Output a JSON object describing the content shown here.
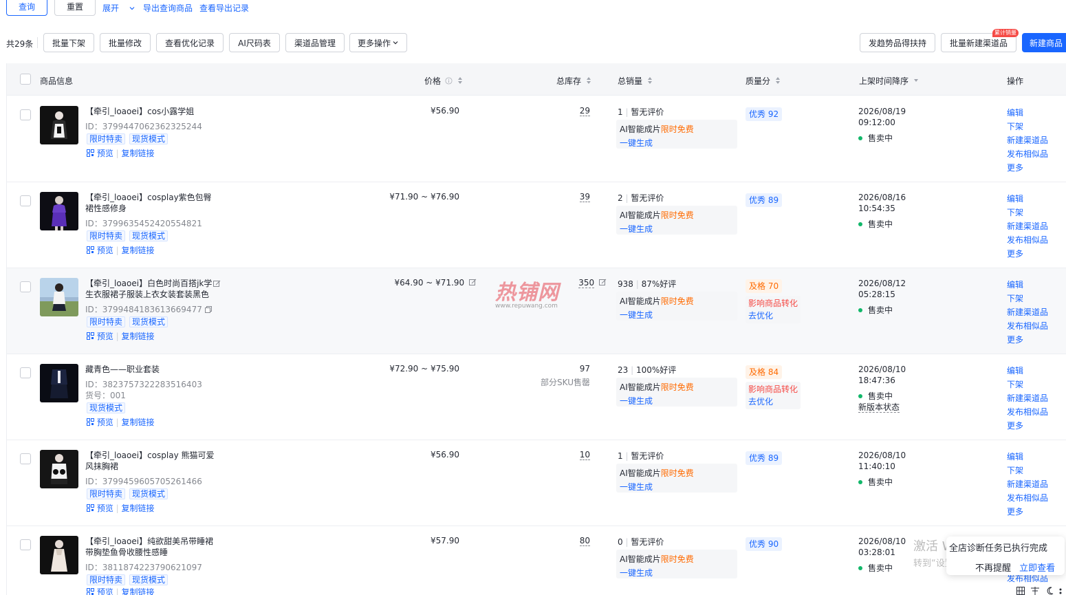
{
  "toolbar": {
    "query": "查询",
    "reset": "重置",
    "expand": "展开",
    "export": "导出查询商品",
    "export_log": "查看导出记录"
  },
  "actions": {
    "total": "共29条",
    "batch_off": "批量下架",
    "batch_edit": "批量修改",
    "opt_log": "查看优化记录",
    "ai_size": "AI尺码表",
    "channel_mgmt": "渠道品管理",
    "more_ops": "更多操作",
    "trend": "发趋势品得扶持",
    "batch_channel": "批量新建渠道品",
    "batch_channel_badge": "累计销量",
    "new_product": "新建商品"
  },
  "columns": {
    "info": "商品信息",
    "price": "价格",
    "stock": "总库存",
    "sales": "总销量",
    "quality": "质量分",
    "time": "上架时间降序",
    "ops": "操作"
  },
  "common": {
    "ai_label": "AI智能成片",
    "free": "限时免费",
    "generate": "一键生成",
    "preview": "预览",
    "copy_link": "复制链接",
    "on_sale": "售卖中",
    "op_edit": "编辑",
    "op_off": "下架",
    "op_new_channel": "新建渠道品",
    "op_similar": "发布相似品",
    "op_more": "更多",
    "impact": "影响商品转化",
    "optimize": "去优化"
  },
  "products": [
    {
      "title": "【牵引_loaoei】cos小露学姐",
      "id": "ID：3799447062362325244",
      "tags": [
        "限时特卖",
        "现货模式"
      ],
      "price": "¥56.90",
      "stock": "29",
      "sales": "1",
      "review": "暂无评价",
      "quality": "优秀 92",
      "quality_level": "good",
      "date": "2026/08/19",
      "time": "09:12:00"
    },
    {
      "title": "【牵引_loaoei】cosplay紫色包臀裙性感修身",
      "id": "ID：3799635452420554821",
      "tags": [
        "限时特卖",
        "现货模式"
      ],
      "price": "¥71.90 ~ ¥76.90",
      "stock": "39",
      "sales": "2",
      "review": "暂无评价",
      "quality": "优秀 89",
      "quality_level": "good",
      "date": "2026/08/16",
      "time": "10:54:35"
    },
    {
      "title": "【牵引_loaoei】白色时尚百搭jk学生衣服裙子服装上衣女装套装黑色",
      "id": "ID：3799484183613669477",
      "tags": [
        "限时特卖",
        "现货模式"
      ],
      "price": "¥64.90 ~ ¥71.90",
      "stock": "350",
      "sales": "938",
      "review": "87%好评",
      "quality": "及格 70",
      "quality_level": "pass",
      "date": "2026/08/12",
      "time": "05:28:15"
    },
    {
      "title": "藏青色——职业套装",
      "id": "ID：3823757322283516403",
      "sku": "货号：001",
      "tags": [
        "现货模式"
      ],
      "price": "¥72.90 ~ ¥75.90",
      "stock": "97",
      "stock_note": "部分SKU售罄",
      "sales": "23",
      "review": "100%好评",
      "quality": "及格 84",
      "quality_level": "pass",
      "date": "2026/08/10",
      "time": "18:47:36",
      "status_note": "新版本状态"
    },
    {
      "title": "【牵引_loaoei】cosplay 熊猫可爱风抹胸裙",
      "id": "ID：3799459605705261466",
      "tags": [
        "限时特卖",
        "现货模式"
      ],
      "price": "¥56.90",
      "stock": "10",
      "sales": "1",
      "review": "暂无评价",
      "quality": "优秀 89",
      "quality_level": "good",
      "date": "2026/08/10",
      "time": "11:40:10"
    },
    {
      "title": "【牵引_loaoei】纯欲甜美吊带睡裙带胸垫鱼骨收腰性感睡",
      "id": "ID：3811874223790621097",
      "tags": [
        "限时特卖",
        "现货模式"
      ],
      "price": "¥57.90",
      "stock": "80",
      "sales": "0",
      "review": "暂无评价",
      "quality": "优秀 90",
      "quality_level": "good",
      "date": "2026/08/10",
      "time": "03:28:01"
    }
  ],
  "watermark": {
    "cn": "热铺网",
    "url": "www.repuwang.com"
  },
  "toast": {
    "message": "全店诊断任务已执行完成",
    "dismiss": "不再提醒",
    "view": "立即查看"
  },
  "windows": {
    "activate": "激活 Windows",
    "hint": "转到“设置”以激活 Windows。"
  }
}
